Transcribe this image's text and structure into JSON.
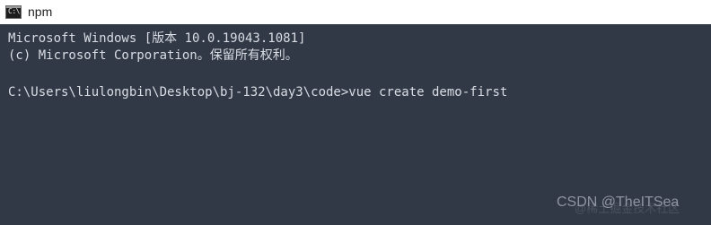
{
  "window": {
    "title": "npm",
    "icon": "cmd-icon",
    "icon_glyph": "C:\\."
  },
  "console": {
    "lines": [
      "Microsoft Windows [版本 10.0.19043.1081]",
      "(c) Microsoft Corporation。保留所有权利。",
      "C:\\Users\\liulongbin\\Desktop\\bj-132\\day3\\code>vue create demo-first"
    ],
    "background": "#313846",
    "foreground": "#d9dde4"
  },
  "watermark": {
    "text": "CSDN @TheITSea",
    "faint_text": "@稀土掘金技术社区"
  }
}
